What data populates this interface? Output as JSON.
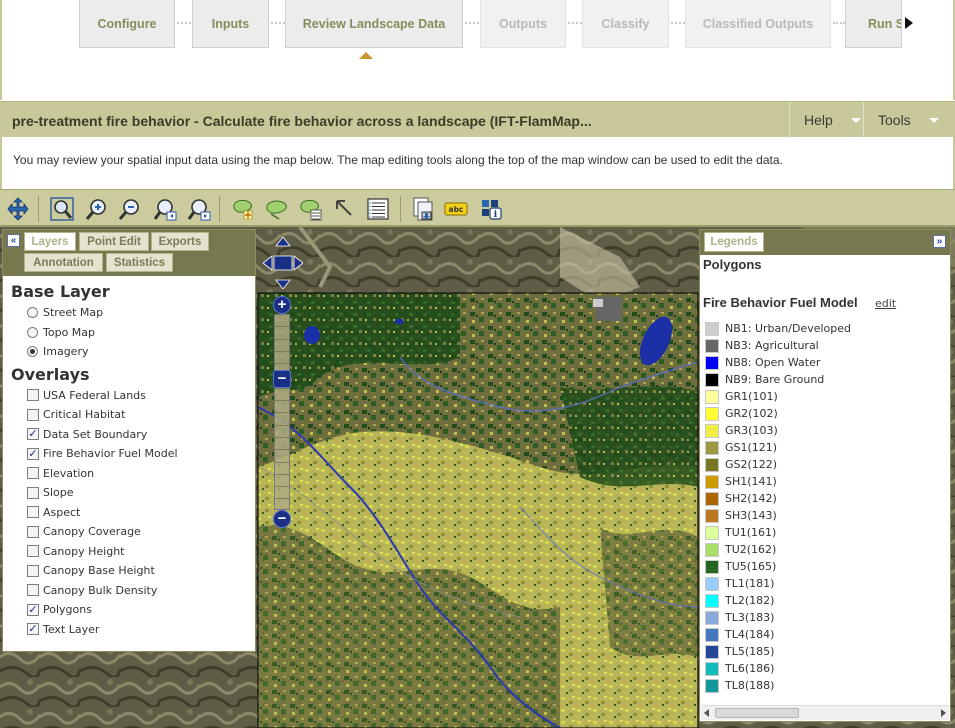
{
  "workflow": {
    "steps": [
      {
        "label": "Configure",
        "state": "done"
      },
      {
        "label": "Inputs",
        "state": "done"
      },
      {
        "label": "Review Landscape Data",
        "state": "current"
      },
      {
        "label": "Outputs",
        "state": "disabled"
      },
      {
        "label": "Classify",
        "state": "disabled"
      },
      {
        "label": "Classified Outputs",
        "state": "disabled"
      },
      {
        "label": "Run S",
        "state": "done"
      }
    ]
  },
  "header": {
    "title": "pre-treatment fire behavior - Calculate fire behavior across a landscape (IFT-FlamMap...",
    "help_label": "Help",
    "tools_label": "Tools"
  },
  "description": "You may review your spatial input data using the map below. The map editing tools along the top of the map window can be used to edit the data.",
  "toolbar": {
    "icons": [
      "pan-icon",
      "zoom-extent-icon",
      "zoom-in-icon",
      "zoom-out-icon",
      "zoom-previous-icon",
      "zoom-next-icon",
      "add-polygon-icon",
      "edit-polygon-icon",
      "polygon-attributes-icon",
      "select-arrow-icon",
      "attribute-table-icon",
      "export-layer-icon",
      "label-text-icon",
      "identify-icon"
    ]
  },
  "left_panel": {
    "tabs": [
      "Layers",
      "Point Edit",
      "Exports",
      "Annotation",
      "Statistics"
    ],
    "active_tab": "Layers",
    "base_layer_heading": "Base Layer",
    "base_layers": [
      {
        "label": "Street Map",
        "selected": false
      },
      {
        "label": "Topo Map",
        "selected": false
      },
      {
        "label": "Imagery",
        "selected": true
      }
    ],
    "overlays_heading": "Overlays",
    "overlays": [
      {
        "label": "USA Federal Lands",
        "checked": false
      },
      {
        "label": "Critical Habitat",
        "checked": false
      },
      {
        "label": "Data Set Boundary",
        "checked": true
      },
      {
        "label": "Fire Behavior Fuel Model",
        "checked": true
      },
      {
        "label": "Elevation",
        "checked": false
      },
      {
        "label": "Slope",
        "checked": false
      },
      {
        "label": "Aspect",
        "checked": false
      },
      {
        "label": "Canopy Coverage",
        "checked": false
      },
      {
        "label": "Canopy Height",
        "checked": false
      },
      {
        "label": "Canopy Base Height",
        "checked": false
      },
      {
        "label": "Canopy Bulk Density",
        "checked": false
      },
      {
        "label": "Polygons",
        "checked": true
      },
      {
        "label": "Text Layer",
        "checked": true
      }
    ]
  },
  "legend_panel": {
    "tab": "Legends",
    "polygons_label": "Polygons",
    "fuel_model_heading": "Fire Behavior Fuel Model",
    "edit_label": "edit",
    "items": [
      {
        "label": "NB1: Urban/Developed",
        "color": "#cccccc"
      },
      {
        "label": "NB3: Agricultural",
        "color": "#666666"
      },
      {
        "label": "NB8: Open Water",
        "color": "#0000ee"
      },
      {
        "label": "NB9: Bare Ground",
        "color": "#000000"
      },
      {
        "label": "GR1(101)",
        "color": "#ffff99"
      },
      {
        "label": "GR2(102)",
        "color": "#ffff33"
      },
      {
        "label": "GR3(103)",
        "color": "#eeee44"
      },
      {
        "label": "GS1(121)",
        "color": "#999944"
      },
      {
        "label": "GS2(122)",
        "color": "#777722"
      },
      {
        "label": "SH1(141)",
        "color": "#cc9900"
      },
      {
        "label": "SH2(142)",
        "color": "#aa6600"
      },
      {
        "label": "SH3(143)",
        "color": "#bb7722"
      },
      {
        "label": "TU1(161)",
        "color": "#ddff99"
      },
      {
        "label": "TU2(162)",
        "color": "#aadd66"
      },
      {
        "label": "TU5(165)",
        "color": "#226622"
      },
      {
        "label": "TL1(181)",
        "color": "#99ccff"
      },
      {
        "label": "TL2(182)",
        "color": "#00ffff"
      },
      {
        "label": "TL3(183)",
        "color": "#88aadd"
      },
      {
        "label": "TL4(184)",
        "color": "#4477bb"
      },
      {
        "label": "TL5(185)",
        "color": "#224499"
      },
      {
        "label": "TL6(186)",
        "color": "#11bbbb"
      },
      {
        "label": "TL8(188)",
        "color": "#119999"
      }
    ]
  },
  "map_controls": {
    "zoom_in_label": "+",
    "zoom_out_label": "−",
    "zoom_mid_label": "−"
  }
}
